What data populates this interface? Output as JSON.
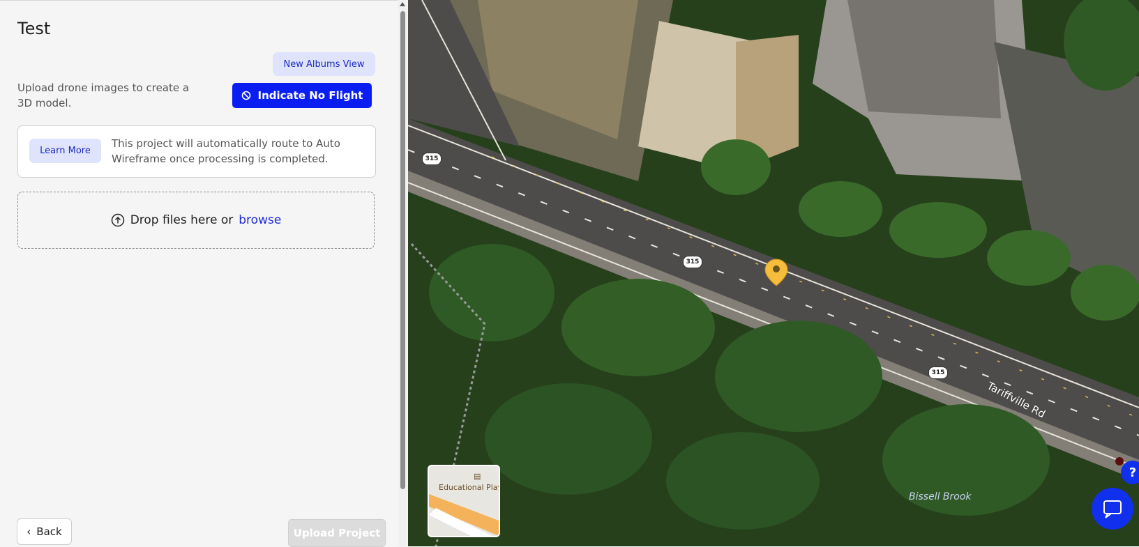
{
  "panel": {
    "title": "Test",
    "albums_button": "New Albums View",
    "description": "Upload drone images to create a 3D model.",
    "no_flight_button": "Indicate No Flight",
    "info": {
      "learn_more": "Learn More",
      "text": "This project will automatically route to Auto Wireframe once processing is completed."
    },
    "dropzone": {
      "text": "Drop files here or",
      "browse": "browse"
    },
    "back_button": "Back",
    "upload_button": "Upload Project"
  },
  "map": {
    "route_shields": [
      "315",
      "315",
      "315"
    ],
    "road_label": "Tariffville Rd",
    "water_label": "Bissell Brook",
    "minimap_label": "Educational Play",
    "help_label": "?"
  },
  "colors": {
    "primary": "#0a1ef2",
    "secondary_bg": "#dfe3fb",
    "pin": "#f6bd3c"
  },
  "icons": [
    "no-flight-icon",
    "upload-icon",
    "chevron-left-icon",
    "map-pin-icon",
    "chat-icon",
    "help-icon"
  ]
}
